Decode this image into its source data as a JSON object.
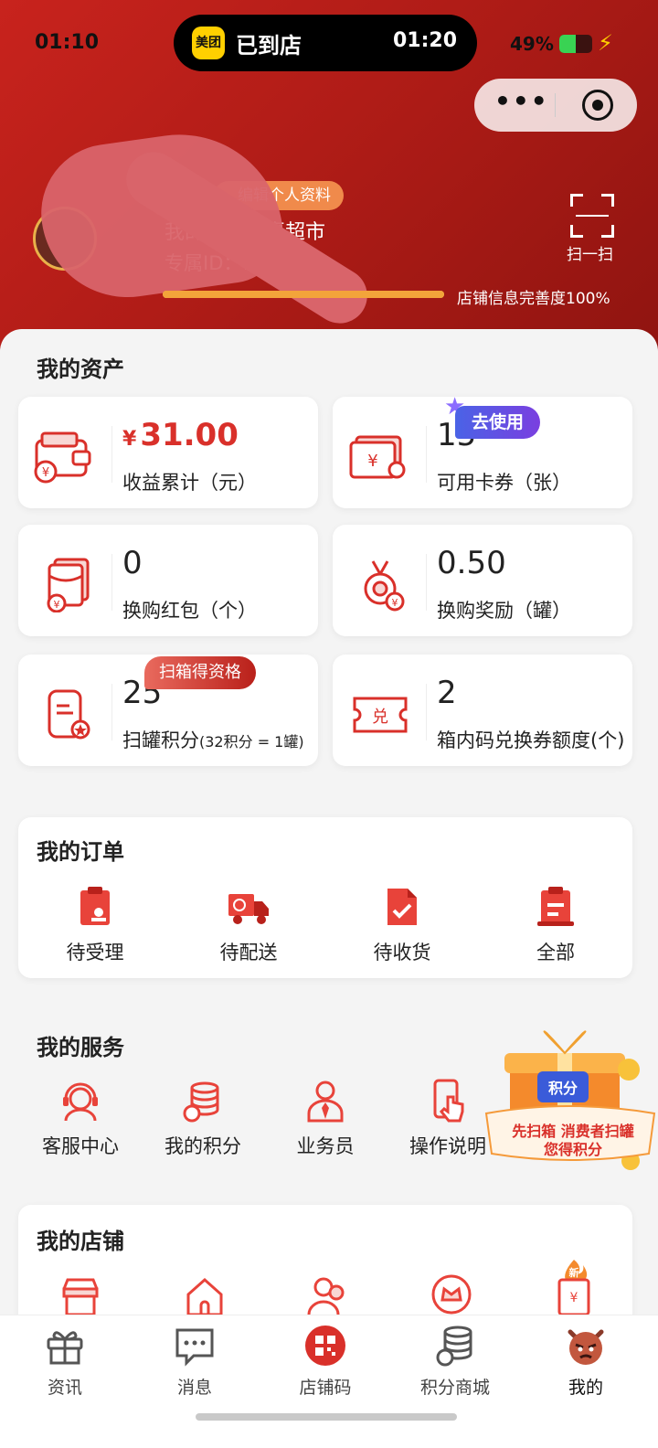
{
  "status_bar": {
    "time": "01:10",
    "island_app_logo": "美团",
    "island_label": "已到店",
    "island_time": "01:20",
    "battery": "49%",
    "battery_level": 0.49
  },
  "profile": {
    "edit_badge": "编辑个人资料",
    "store_name": "我的店铺：惠超市",
    "exclusive_id": "专属ID：11",
    "completeness_level": 1.0,
    "completeness_text": "店铺信息完善度100%",
    "scan_label": "扫一扫"
  },
  "assets": {
    "title": "我的资产",
    "items": [
      {
        "currency": "¥",
        "value": "31.00",
        "label": "收益累计（元）",
        "icon": "wallet-icon"
      },
      {
        "value": "15",
        "label": "可用卡券（张）",
        "badge": "去使用",
        "icon": "coupon-icon"
      },
      {
        "value": "0",
        "label": "换购红包（个）",
        "icon": "red-envelope-icon"
      },
      {
        "value": "0.50",
        "label": "换购奖励（罐）",
        "icon": "medal-icon"
      },
      {
        "value": "25",
        "label": "扫罐积分",
        "label_note": "(32积分 = 1罐)",
        "badge": "扫箱得资格",
        "icon": "can-icon"
      },
      {
        "value": "2",
        "label": "箱内码兑换券额度(个)",
        "icon": "exchange-ticket-icon"
      }
    ]
  },
  "orders": {
    "title": "我的订单",
    "items": [
      {
        "label": "待受理",
        "icon": "pending-order-icon"
      },
      {
        "label": "待配送",
        "icon": "delivery-truck-icon"
      },
      {
        "label": "待收货",
        "icon": "receive-check-icon"
      },
      {
        "label": "全部",
        "icon": "clipboard-icon"
      }
    ]
  },
  "services": {
    "title": "我的服务",
    "items": [
      {
        "label": "客服中心",
        "icon": "headset-icon"
      },
      {
        "label": "我的积分",
        "icon": "coin-stack-icon"
      },
      {
        "label": "业务员",
        "icon": "salesman-icon"
      },
      {
        "label": "操作说明",
        "icon": "touch-guide-icon"
      }
    ]
  },
  "promo": {
    "badge": "积分",
    "line1": "先扫箱 消费者扫罐",
    "line2": "您得积分"
  },
  "store": {
    "title": "我的店铺",
    "new_badge": "新",
    "items": [
      {
        "icon": "storefront-icon"
      },
      {
        "icon": "house-icon"
      },
      {
        "icon": "people-icon"
      },
      {
        "icon": "crown-icon"
      },
      {
        "icon": "receipt-icon"
      }
    ]
  },
  "tabbar": {
    "items": [
      {
        "label": "资讯",
        "icon": "gift-box-icon"
      },
      {
        "label": "消息",
        "icon": "chat-bubble-icon"
      },
      {
        "label": "店铺码",
        "icon": "qr-code-icon"
      },
      {
        "label": "积分商城",
        "icon": "coin-stack-icon"
      },
      {
        "label": "我的",
        "icon": "mascot-avatar-icon",
        "active": true
      }
    ]
  },
  "colors": {
    "brand_red": "#d9302a",
    "header_red": "#b01c17",
    "badge_purple": "#5b4fe6",
    "progress_orange": "#f3a43a"
  }
}
